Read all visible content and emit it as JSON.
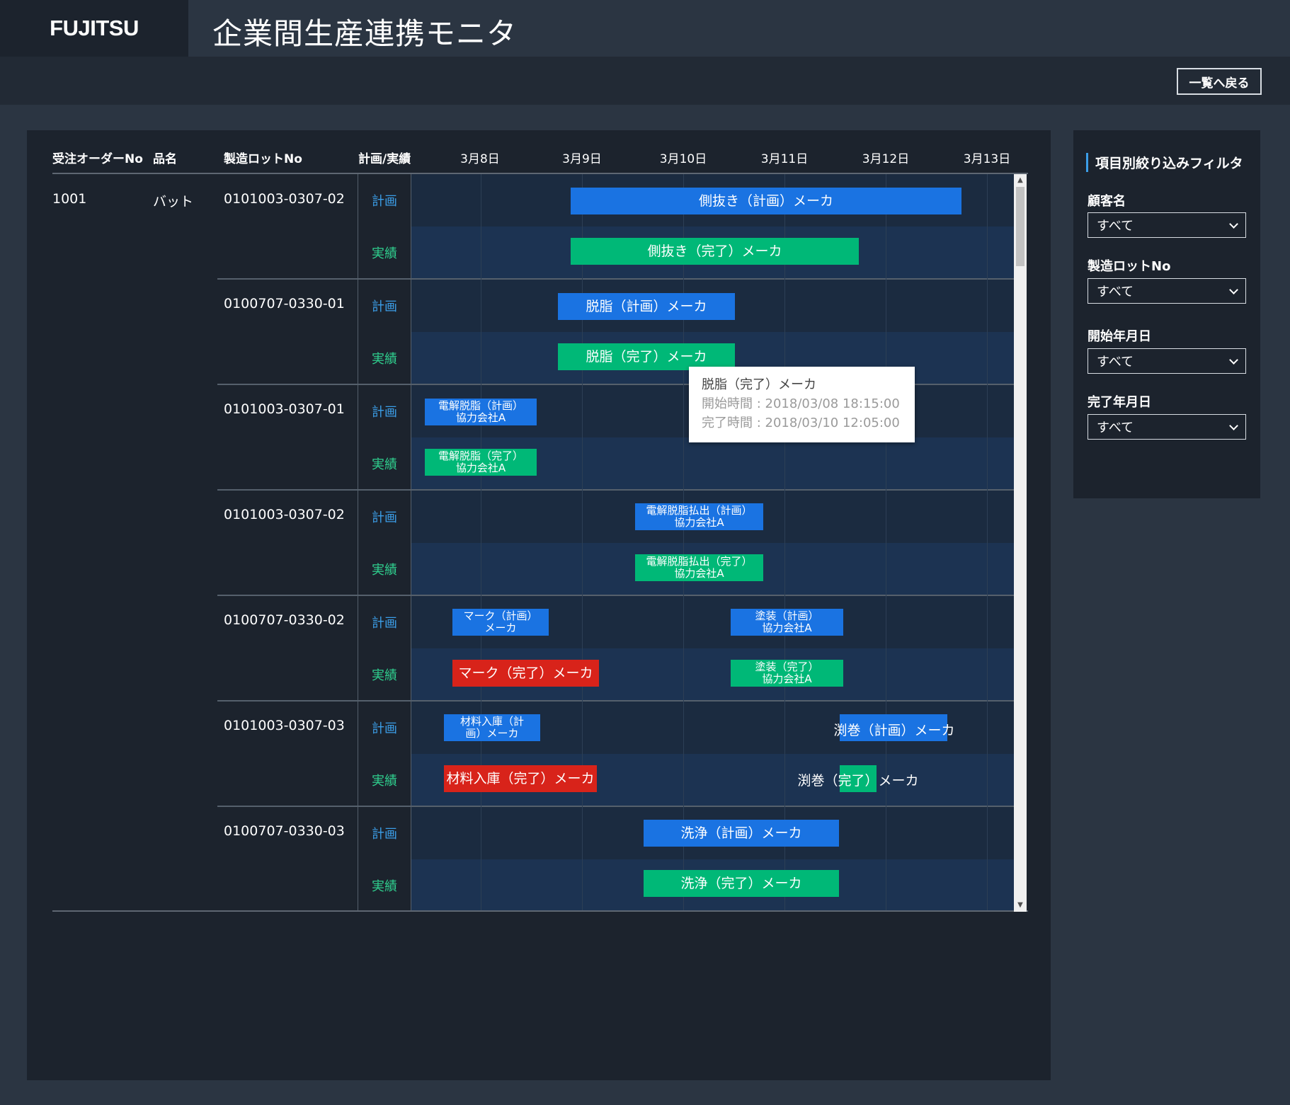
{
  "header": {
    "logo": "FUJITSU",
    "title": "企業間生産連携モニタ"
  },
  "toolbar": {
    "back_label": "一覧へ戻る"
  },
  "table": {
    "columns": {
      "order_no": "受注オーダーNo",
      "item_name": "品名",
      "lot_no": "製造ロットNo",
      "kind": "計画/実績"
    },
    "dates": [
      "3月8日",
      "3月9日",
      "3月10日",
      "3月11日",
      "3月12日",
      "3月13日"
    ],
    "order": {
      "order_no": "1001",
      "item_name": "バット"
    },
    "kind_labels": {
      "plan": "計画",
      "actual": "実績"
    },
    "groups": [
      {
        "lot_no": "0101003-0307-02",
        "plan": [
          {
            "label": "側抜き（計画）メーカ"
          }
        ],
        "actual": [
          {
            "label": "側抜き（完了）メーカ"
          }
        ]
      },
      {
        "lot_no": "0100707-0330-01",
        "plan": [
          {
            "label": "脱脂（計画）メーカ"
          }
        ],
        "actual": [
          {
            "label": "脱脂（完了）メーカ"
          }
        ]
      },
      {
        "lot_no": "0101003-0307-01",
        "plan": [
          {
            "line1": "電解脱脂（計画）",
            "line2": "協力会社A"
          }
        ],
        "actual": [
          {
            "line1": "電解脱脂（完了）",
            "line2": "協力会社A"
          }
        ]
      },
      {
        "lot_no": "0101003-0307-02",
        "plan": [
          {
            "line1": "電解脱脂払出（計画）",
            "line2": "協力会社A"
          }
        ],
        "actual": [
          {
            "line1": "電解脱脂払出（完了）",
            "line2": "協力会社A"
          }
        ]
      },
      {
        "lot_no": "0100707-0330-02",
        "plan": [
          {
            "line1": "マーク（計画）",
            "line2": "メーカ"
          },
          {
            "line1": "塗装（計画）",
            "line2": "協力会社A"
          }
        ],
        "actual": [
          {
            "label": "マーク（完了）メーカ"
          },
          {
            "line1": "塗装（完了）",
            "line2": "協力会社A"
          }
        ]
      },
      {
        "lot_no": "0101003-0307-03",
        "plan": [
          {
            "line1": "材料入庫（計",
            "line2": "画）メーカ"
          },
          {
            "label": "渕巻（計画）メーカ"
          }
        ],
        "actual": [
          {
            "label": "材料入庫（完了）メーカ"
          },
          {
            "label": "渕巻（完了）メーカ"
          }
        ]
      },
      {
        "lot_no": "0100707-0330-03",
        "plan": [
          {
            "label": "洗浄（計画）メーカ"
          }
        ],
        "actual": [
          {
            "label": "洗浄（完了）メーカ"
          }
        ]
      }
    ]
  },
  "tooltip": {
    "title": "脱脂（完了）メーカ",
    "start": "開始時間 : 2018/03/08 18:15:00",
    "end": "完了時間 : 2018/03/10 12:05:00"
  },
  "filter": {
    "title": "項目別絞り込みフィルタ",
    "fields": [
      {
        "label": "顧客名",
        "value": "すべて"
      },
      {
        "label": "製造ロットNo",
        "value": "すべて"
      },
      {
        "label": "開始年月日",
        "value": "すべて"
      },
      {
        "label": "完了年月日",
        "value": "すべて"
      }
    ]
  },
  "colors": {
    "plan_bar": "#1a73e2",
    "actual_bar": "#00b877",
    "late_bar": "#d8231a",
    "plan_text": "#3b9ee8",
    "actual_text": "#2fcf8e"
  }
}
